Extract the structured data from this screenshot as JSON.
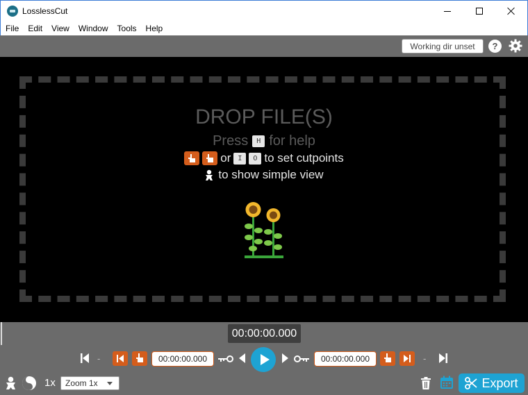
{
  "window": {
    "title": "LosslessCut"
  },
  "menu": {
    "items": [
      "File",
      "Edit",
      "View",
      "Window",
      "Tools",
      "Help"
    ]
  },
  "toolbar": {
    "workdir_label": "Working dir unset",
    "help_label": "?"
  },
  "drop": {
    "title": "DROP FILE(S)",
    "help_press": "Press",
    "help_key": "H",
    "help_suffix": "for help",
    "cut_or": "or",
    "cut_key_in": "I",
    "cut_key_out": "O",
    "cut_suffix": "to set cutpoints",
    "simple_suffix": "to show simple view"
  },
  "timeline": {
    "current_time": "00:00:00.000"
  },
  "controls": {
    "start_time": "00:00:00.000",
    "end_time": "00:00:00.000",
    "dash": "-"
  },
  "bottom": {
    "speed": "1x",
    "zoom_label": "Zoom 1x",
    "export_label": "Export"
  },
  "colors": {
    "accent": "#1ea3d3",
    "orange": "#d45d1c",
    "panel": "#6b6b6b"
  }
}
